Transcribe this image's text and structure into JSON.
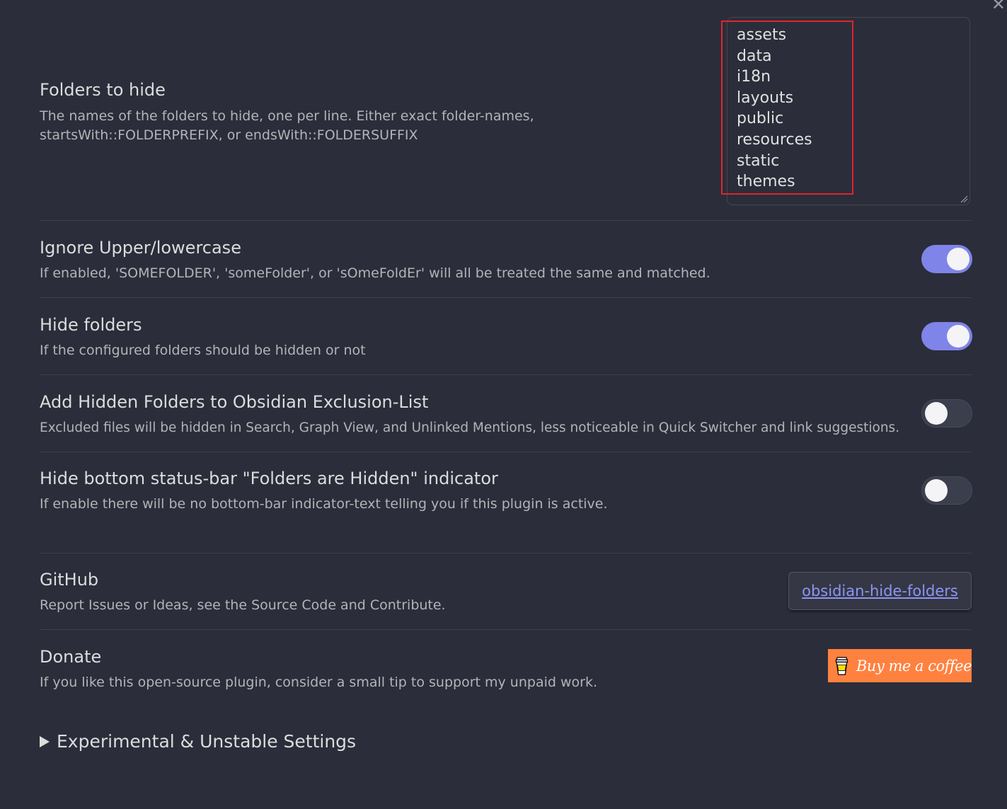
{
  "settings": {
    "folders_to_hide": {
      "name": "Folders to hide",
      "desc": "The names of the folders to hide, one per line. Either exact folder-names, startsWith::FOLDERPREFIX, or endsWith::FOLDERSUFFIX",
      "value": "assets\ndata\ni18n\nlayouts\npublic\nresources\nstatic\nthemes"
    },
    "ignore_case": {
      "name": "Ignore Upper/lowercase",
      "desc": "If enabled, 'SOMEFOLDER', 'someFolder', or 'sOmeFoldEr' will all be treated the same and matched.",
      "enabled": true
    },
    "hide_folders": {
      "name": "Hide folders",
      "desc": "If the configured folders should be hidden or not",
      "enabled": true
    },
    "exclusion_list": {
      "name": "Add Hidden Folders to Obsidian Exclusion-List",
      "desc": "Excluded files will be hidden in Search, Graph View, and Unlinked Mentions, less noticeable in Quick Switcher and link suggestions.",
      "enabled": false
    },
    "hide_indicator": {
      "name": "Hide bottom status-bar \"Folders are Hidden\" indicator",
      "desc": "If enable there will be no bottom-bar indicator-text telling you if this plugin is active.",
      "enabled": false
    },
    "github": {
      "name": "GitHub",
      "desc": "Report Issues or Ideas, see the Source Code and Contribute.",
      "link_label": "obsidian-hide-folders"
    },
    "donate": {
      "name": "Donate",
      "desc": "If you like this open-source plugin, consider a small tip to support my unpaid work.",
      "button_label": "Buy me a coffee"
    }
  },
  "experimental": {
    "label": "Experimental & Unstable Settings"
  },
  "icons": {
    "close": "close-icon",
    "cup": "coffee-cup-icon",
    "disclosure": "triangle-right-icon"
  },
  "colors": {
    "background": "#2b2d3a",
    "toggle_on": "#7f84e8",
    "link": "#8b95f5",
    "bmc": "#ff813f",
    "highlight": "#e0252e"
  }
}
